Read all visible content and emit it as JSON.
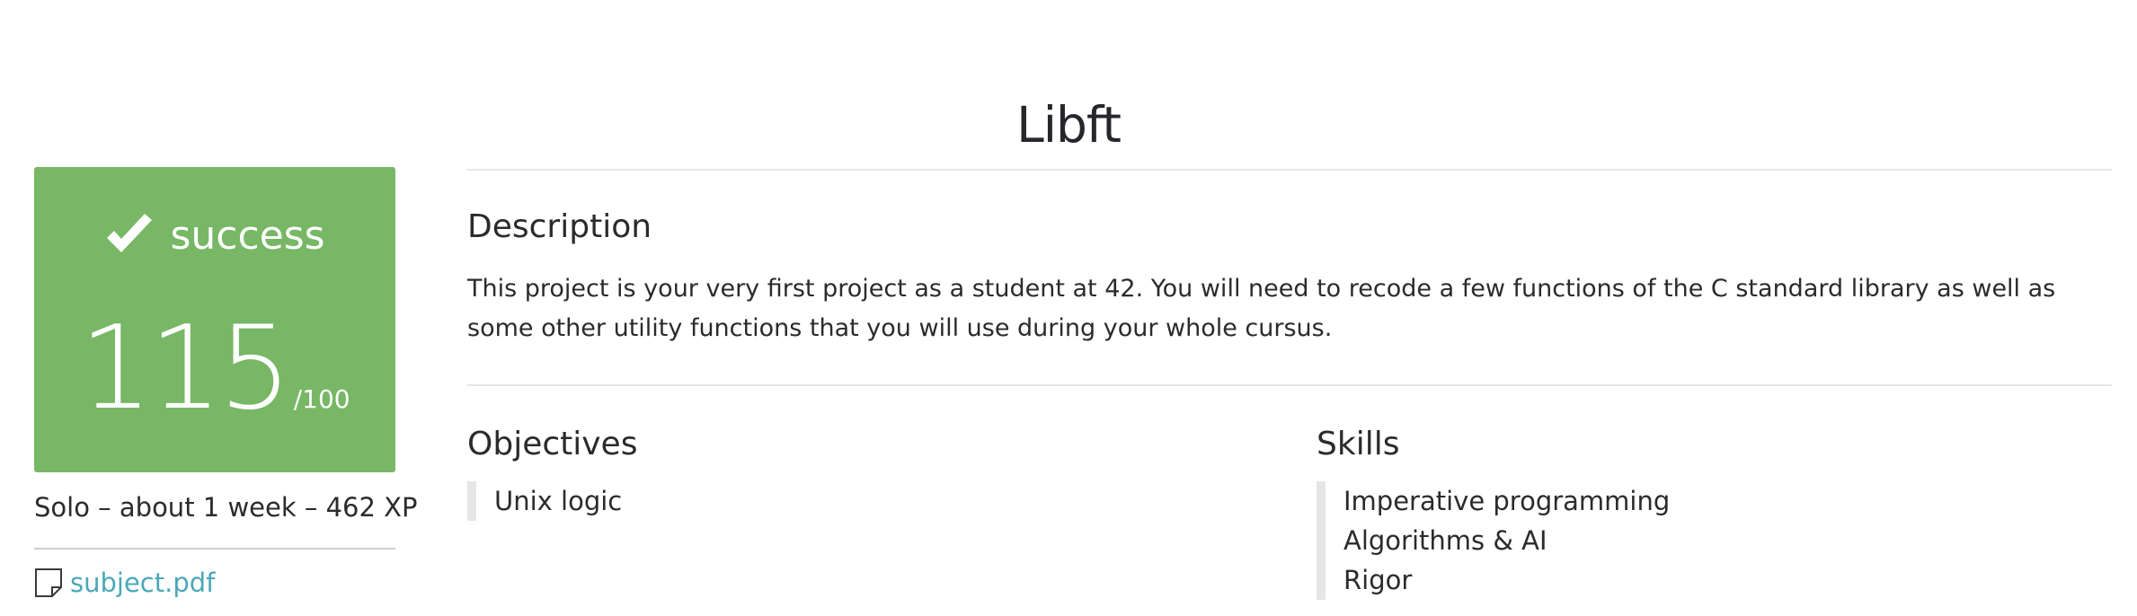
{
  "page": {
    "title": "Libft"
  },
  "result": {
    "status": "success",
    "score": "115",
    "score_max": "/100",
    "status_color": "#77b765",
    "status_icon": "check-icon"
  },
  "project": {
    "meta": "Solo – about 1 week – 462 XP",
    "attachment_label": "subject.pdf",
    "attachment_icon": "file-icon",
    "link_color": "#4aa8b9"
  },
  "description": {
    "heading": "Description",
    "text": "This project is your very first project as a student at 42. You will need to recode a few functions of the C standard library as well as some other utility functions that you will use during your whole cursus."
  },
  "objectives": {
    "heading": "Objectives",
    "items": [
      "Unix logic"
    ]
  },
  "skills": {
    "heading": "Skills",
    "items": [
      "Imperative programming",
      "Algorithms & AI",
      "Rigor"
    ]
  }
}
